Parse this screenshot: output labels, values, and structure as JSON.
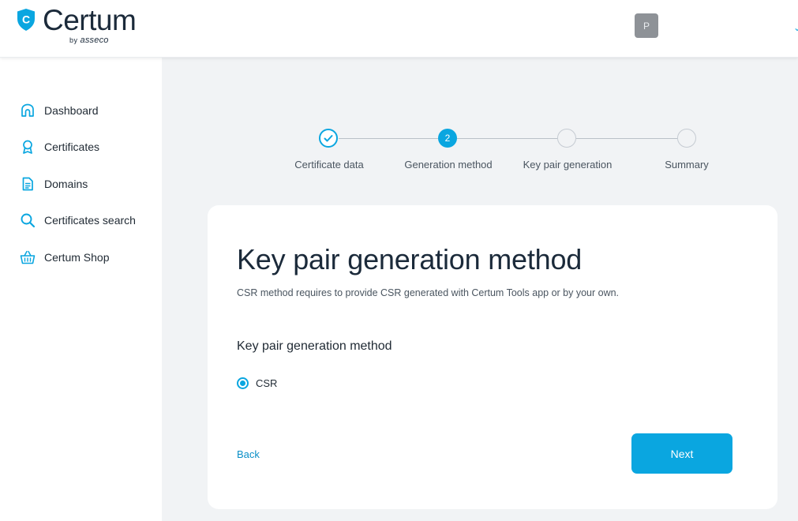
{
  "brand": {
    "name": "Certum",
    "by_prefix": "by",
    "by_name": "asseco",
    "shield_letter": "C",
    "shield_color": "#0aa6e0"
  },
  "header": {
    "avatar_initial": "P"
  },
  "sidebar": {
    "items": [
      {
        "label": "Dashboard",
        "icon": "home-icon"
      },
      {
        "label": "Certificates",
        "icon": "certificate-icon"
      },
      {
        "label": "Domains",
        "icon": "document-icon"
      },
      {
        "label": "Certificates search",
        "icon": "search-icon"
      },
      {
        "label": "Certum Shop",
        "icon": "basket-icon"
      }
    ]
  },
  "stepper": {
    "steps": [
      {
        "label": "Certificate data",
        "state": "done"
      },
      {
        "label": "Generation method",
        "state": "active",
        "number": "2"
      },
      {
        "label": "Key pair generation",
        "state": "todo"
      },
      {
        "label": "Summary",
        "state": "todo"
      }
    ]
  },
  "card": {
    "title": "Key pair generation method",
    "description": "CSR method requires to provide CSR generated with Certum Tools app or by your own.",
    "section_label": "Key pair generation method",
    "options": [
      {
        "label": "CSR",
        "selected": true
      }
    ],
    "back_label": "Back",
    "next_label": "Next"
  },
  "colors": {
    "accent": "#0aa6e0",
    "background": "#f1f3f5",
    "text": "#1f2933"
  }
}
